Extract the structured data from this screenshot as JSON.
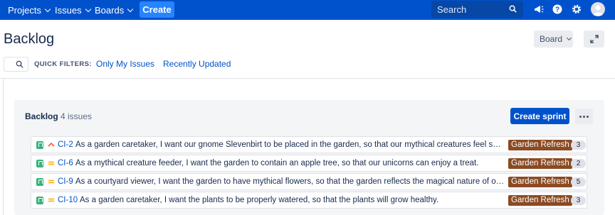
{
  "nav": {
    "items": [
      {
        "label": "Projects"
      },
      {
        "label": "Issues"
      },
      {
        "label": "Boards"
      }
    ],
    "create_label": "Create",
    "search_placeholder": "Search",
    "icons": [
      "notifications-icon",
      "help-icon",
      "settings-icon"
    ]
  },
  "header": {
    "title": "Backlog",
    "board_button": "Board"
  },
  "quick_filters": {
    "label": "QUICK FILTERS:",
    "links": [
      "Only My Issues",
      "Recently Updated"
    ]
  },
  "backlog": {
    "title": "Backlog",
    "count": "4 issues",
    "create_sprint_label": "Create sprint",
    "colors": {
      "epic": "#8b4a22",
      "story": "#36b37e",
      "priority_high": "#ff5630",
      "priority_medium": "#ffab00"
    },
    "issues": [
      {
        "key": "CI-2",
        "priority": "high",
        "summary": "As a garden caretaker, I want our gnome Slevenbirt to be placed in the garden, so that our mythical creatures feel safe in t...",
        "epic": "Garden Refresh",
        "points": "3"
      },
      {
        "key": "CI-6",
        "priority": "medium",
        "summary": "As a mythical creature feeder, I want the garden to contain an apple tree, so that our unicorns can enjoy a treat.",
        "epic": "Garden Refresh",
        "points": "2"
      },
      {
        "key": "CI-9",
        "priority": "medium",
        "summary": "As a courtyard viewer, I want the garden to have mythical flowers, so that the garden reflects the magical nature of our org...",
        "epic": "Garden Refresh",
        "points": "5"
      },
      {
        "key": "CI-10",
        "priority": "medium",
        "summary": "As a garden caretaker, I want the plants to be properly watered, so that the plants will grow healthy.",
        "epic": "Garden Refresh",
        "points": "3"
      }
    ]
  }
}
